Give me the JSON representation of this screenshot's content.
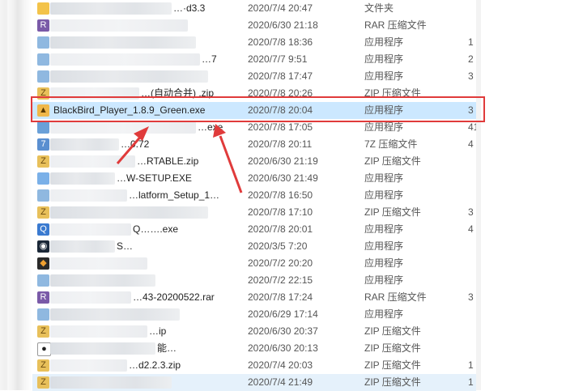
{
  "colors": {
    "selection": "#cce8ff",
    "highlight_box": "#e03b3b",
    "arrow": "#e03b3b"
  },
  "files": [
    {
      "name": "…·d3.3",
      "date": "2020/7/4 20:47",
      "type": "文件夹",
      "size": "",
      "icon": "folder-icon",
      "blur_w": 150
    },
    {
      "name": "",
      "date": "2020/6/30 21:18",
      "type": "RAR 压缩文件",
      "size": "",
      "icon": "rar-icon",
      "blur_w": 170
    },
    {
      "name": "",
      "date": "2020/7/8 18:36",
      "type": "应用程序",
      "size": "1",
      "icon": "app-icon",
      "blur_w": 180
    },
    {
      "name": "…7",
      "date": "2020/7/7 9:51",
      "type": "应用程序",
      "size": "2",
      "icon": "app-icon",
      "blur_w": 185
    },
    {
      "name": "",
      "date": "2020/7/8 17:47",
      "type": "应用程序",
      "size": "3",
      "icon": "app-icon",
      "blur_w": 195
    },
    {
      "name": "…(自动合并) .zip",
      "date": "2020/7/8 20:26",
      "type": "ZIP 压缩文件",
      "size": "",
      "icon": "zip-icon",
      "blur_w": 110
    },
    {
      "name": "BlackBird_Player_1.8.9_Green.exe",
      "date": "2020/7/8 20:04",
      "type": "应用程序",
      "size": "3",
      "icon": "blackbird-exe-icon",
      "blur_w": 0
    },
    {
      "name": "…exe",
      "date": "2020/7/8 17:05",
      "type": "应用程序",
      "size": "41",
      "icon": "exe-icon",
      "blur_w": 180
    },
    {
      "name": "…0.72",
      "date": "2020/7/8 20:11",
      "type": "7Z 压缩文件",
      "size": "4",
      "icon": "7z-icon",
      "blur_w": 85
    },
    {
      "name": "…RTABLE.zip",
      "date": "2020/6/30 21:19",
      "type": "ZIP 压缩文件",
      "size": "",
      "icon": "zip-icon",
      "blur_w": 105
    },
    {
      "name": "…W-SETUP.EXE",
      "date": "2020/6/30 21:49",
      "type": "应用程序",
      "size": "",
      "icon": "setup-icon",
      "blur_w": 80
    },
    {
      "name": "…latform_Setup_1…",
      "date": "2020/7/8 16:50",
      "type": "应用程序",
      "size": "",
      "icon": "app-icon",
      "blur_w": 95
    },
    {
      "name": "",
      "date": "2020/7/8 17:10",
      "type": "ZIP 压缩文件",
      "size": "3",
      "icon": "zip-icon",
      "blur_w": 195
    },
    {
      "name": "Q…….exe",
      "date": "2020/7/8 20:01",
      "type": "应用程序",
      "size": "4",
      "icon": "qq-icon",
      "blur_w": 100
    },
    {
      "name": "S…",
      "date": "2020/3/5 7:20",
      "type": "应用程序",
      "size": "",
      "icon": "steam-icon",
      "blur_w": 80
    },
    {
      "name": "",
      "date": "2020/7/2 20:20",
      "type": "应用程序",
      "size": "",
      "icon": "cat-icon",
      "blur_w": 120
    },
    {
      "name": "",
      "date": "2020/7/2 22:15",
      "type": "应用程序",
      "size": "",
      "icon": "app-icon",
      "blur_w": 130
    },
    {
      "name": "…43-20200522.rar",
      "date": "2020/7/8 17:24",
      "type": "RAR 压缩文件",
      "size": "3",
      "icon": "rar-icon",
      "blur_w": 100
    },
    {
      "name": "",
      "date": "2020/6/29 17:14",
      "type": "应用程序",
      "size": "",
      "icon": "app-icon",
      "blur_w": 160
    },
    {
      "name": "…ip",
      "date": "2020/6/30 20:37",
      "type": "ZIP 压缩文件",
      "size": "",
      "icon": "zip-icon",
      "blur_w": 120
    },
    {
      "name": "能…",
      "date": "2020/6/30 20:13",
      "type": "ZIP 压缩文件",
      "size": "",
      "icon": "panda-icon",
      "blur_w": 130
    },
    {
      "name": "…d2.2.3.zip",
      "date": "2020/7/4 20:03",
      "type": "ZIP 压缩文件",
      "size": "1",
      "icon": "zip-icon",
      "blur_w": 95
    },
    {
      "name": "",
      "date": "2020/7/4 21:49",
      "type": "ZIP 压缩文件",
      "size": "1",
      "icon": "zip-icon",
      "blur_w": 150
    }
  ]
}
